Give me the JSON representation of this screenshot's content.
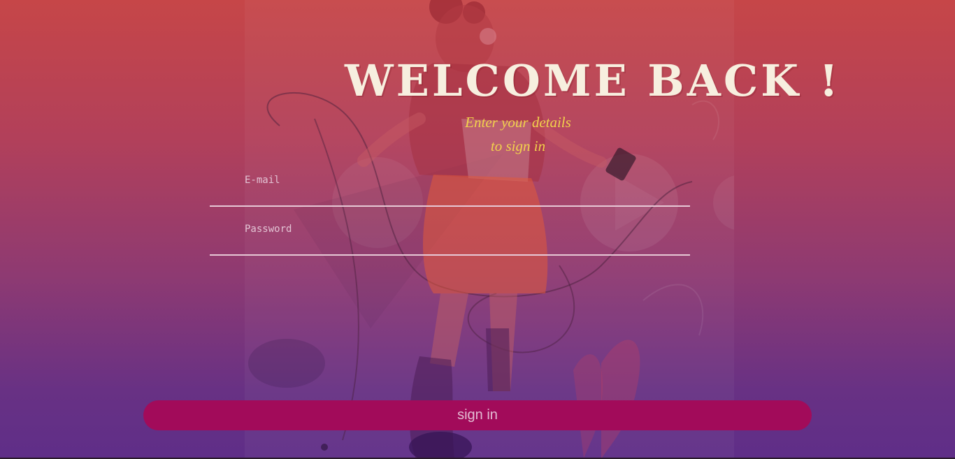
{
  "page": {
    "title": "WELCOME BACK !",
    "subtitle_line1": "Enter your details",
    "subtitle_line2": "to sign in"
  },
  "form": {
    "email": {
      "placeholder": "E-mail",
      "value": ""
    },
    "password": {
      "placeholder": "Password",
      "value": ""
    },
    "submit_label": "sign in"
  },
  "colors": {
    "background_top": "#c64648",
    "background_bottom": "#5f2e88",
    "title": "#f7efdf",
    "subtitle": "#f2d24c",
    "button": "#a20b5a",
    "button_text": "#e3bcd3"
  },
  "illustration": {
    "icon": "dancing-girl-with-headphones-illustration"
  }
}
